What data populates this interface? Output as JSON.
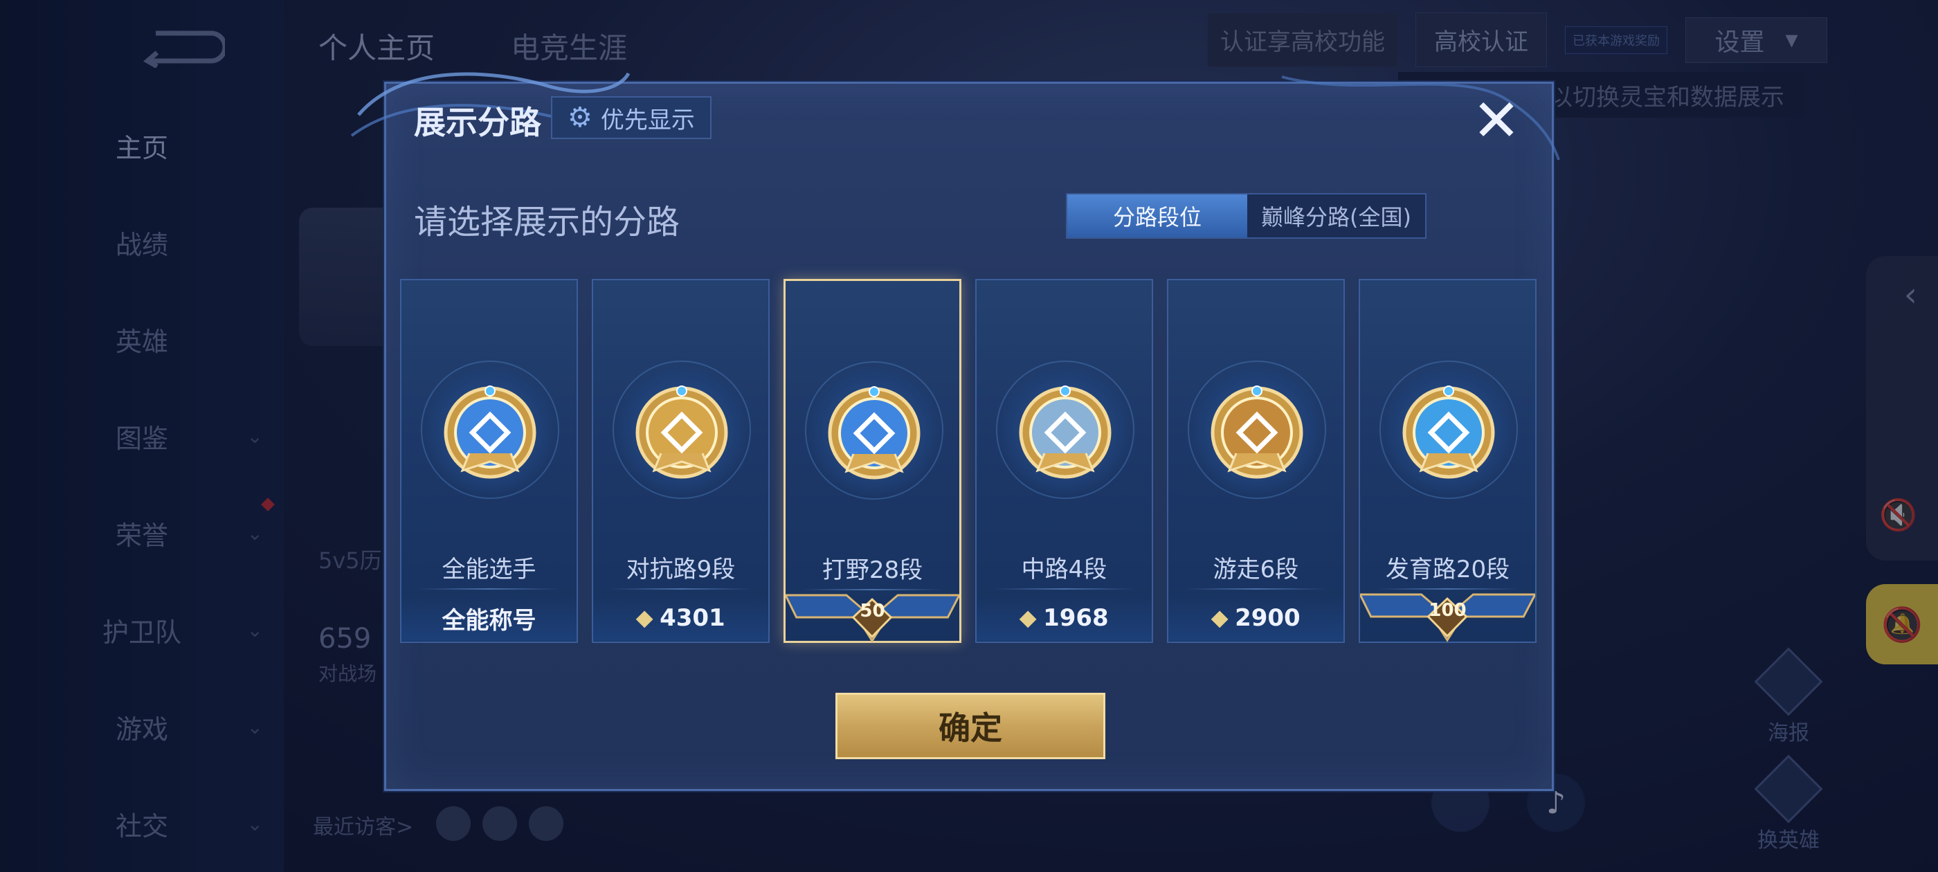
{
  "background": {
    "nav": [
      "主页",
      "战绩",
      "英雄",
      "图鉴",
      "荣誉",
      "护卫队",
      "游戏",
      "社交"
    ],
    "top_tabs": [
      "个人主页",
      "电竞生涯"
    ],
    "cert_tip": "认证享高校功能",
    "cert_btn": "高校认证",
    "cert_mini": "已获本游戏奖励",
    "settings": "设置",
    "switch_tip": "以切换灵宝和数据展示",
    "side_label_1": "5v5历",
    "side_count": "659",
    "side_label_2": "对战场",
    "visitor": "最近访客>",
    "hero_btn_1": "海报",
    "hero_btn_2": "换英雄"
  },
  "modal": {
    "title": "展示分路",
    "priority_label": "优先显示",
    "subtitle": "请选择展示的分路",
    "segments": [
      "分路段位",
      "巅峰分路(全国)"
    ],
    "active_segment": 0,
    "cards": [
      {
        "name": "全能选手",
        "bottom_text": "全能称号",
        "selected": false,
        "badge_color": "#3f86e0"
      },
      {
        "name": "对抗路9段",
        "bottom_text": "4301",
        "selected": false,
        "badge_color": "#d6a64a"
      },
      {
        "name": "打野28段",
        "bottom_text": "50",
        "selected": true,
        "badge_color": "#3f86e0"
      },
      {
        "name": "中路4段",
        "bottom_text": "1968",
        "selected": false,
        "badge_color": "#8ab2d6"
      },
      {
        "name": "游走6段",
        "bottom_text": "2900",
        "selected": false,
        "badge_color": "#c48a3c"
      },
      {
        "name": "发育路20段",
        "bottom_text": "100",
        "selected": false,
        "badge_color": "#3fa0e8"
      }
    ],
    "confirm_label": "确定"
  },
  "colors": {
    "accent_gold": "#e2c47e",
    "accent_blue": "#4f86d4",
    "bell_yellow": "#f5d646"
  }
}
